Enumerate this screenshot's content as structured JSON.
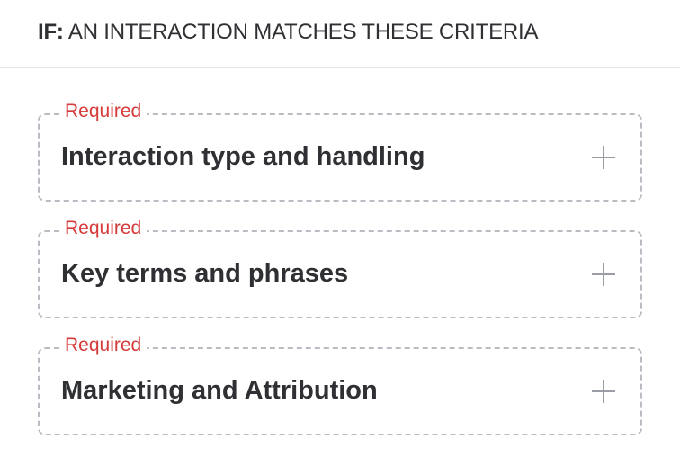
{
  "header": {
    "prefix": "IF:",
    "text": "AN INTERACTION MATCHES THESE CRITERIA"
  },
  "criteria": [
    {
      "required_label": "Required",
      "title": "Interaction type and handling",
      "icon": "plus-icon"
    },
    {
      "required_label": "Required",
      "title": "Key terms and phrases",
      "icon": "plus-icon"
    },
    {
      "required_label": "Required",
      "title": "Marketing and Attribution",
      "icon": "plus-icon"
    }
  ],
  "colors": {
    "required": "#d63b3b",
    "text": "#2f3033",
    "dashed_border": "#b9bcc2",
    "icon": "#9a9da3",
    "divider": "#e4e5e8"
  }
}
